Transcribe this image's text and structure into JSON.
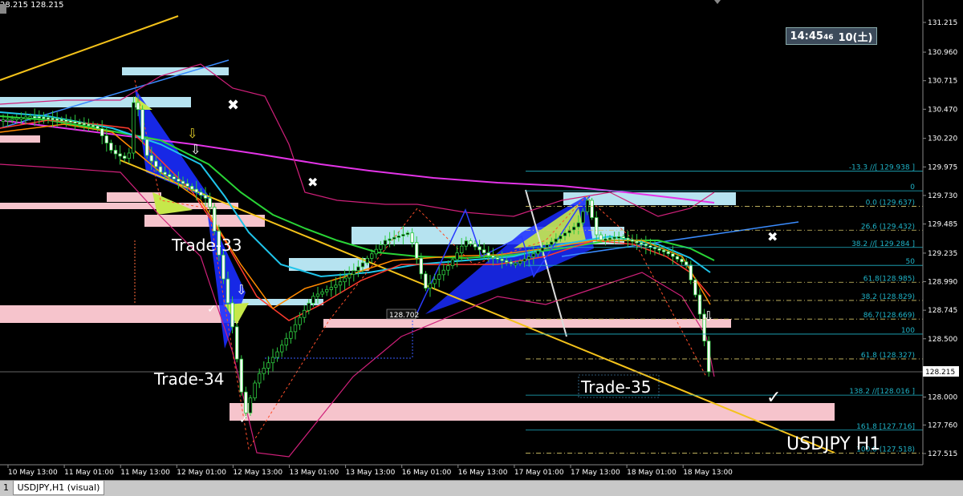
{
  "header": {
    "quote": "28.215 128.215"
  },
  "clock": {
    "time": "14:45",
    "seconds": "46",
    "date": "10(土)"
  },
  "tabs": {
    "index": "1",
    "active": "USDJPY,H1 (visual)"
  },
  "chart_data": {
    "type": "candlestick",
    "symbol_label": "USDJPY H1",
    "ylim": [
      127.4,
      131.35
    ],
    "price_axis_ticks": [
      "131.215",
      "130.960",
      "130.715",
      "130.470",
      "130.220",
      "129.975",
      "129.730",
      "129.485",
      "129.235",
      "128.990",
      "128.745",
      "128.500",
      "128.215",
      "128.000",
      "127.760",
      "127.515"
    ],
    "current_price": "128.215",
    "time_axis_ticks": [
      "10 May 13:00",
      "11 May 01:00",
      "11 May 13:00",
      "12 May 01:00",
      "12 May 13:00",
      "13 May 01:00",
      "13 May 13:00",
      "16 May 01:00",
      "16 May 13:00",
      "17 May 01:00",
      "17 May 13:00",
      "18 May 01:00",
      "18 May 13:00"
    ],
    "fibonacci_levels": [
      {
        "label": "-13.3  //[ 129.938 ]",
        "price": 129.938
      },
      {
        "label": "0",
        "price": 129.77
      },
      {
        "label": "0.0 (129.637)",
        "price": 129.637
      },
      {
        "label": "26.6 (129.432)",
        "price": 129.432
      },
      {
        "label": "38.2  //[ 129.284 ]",
        "price": 129.284
      },
      {
        "label": "50",
        "price": 129.13
      },
      {
        "label": "61.8(128.985)",
        "price": 128.985
      },
      {
        "label": "38.2 (128.829)",
        "price": 128.829
      },
      {
        "label": "86.7(128.669)",
        "price": 128.669
      },
      {
        "label": "100",
        "price": 128.54
      },
      {
        "label": "61.8 (128.327)",
        "price": 128.327
      },
      {
        "label": "138.2  //[128.016 ]",
        "price": 128.016
      },
      {
        "label": "161.8 [127.716]",
        "price": 127.716
      },
      {
        "label": "100.0 (127.518)",
        "price": 127.518
      }
    ],
    "annotations": [
      "Trade-33",
      "Trade-34",
      "Trade-35",
      "128.702"
    ]
  }
}
